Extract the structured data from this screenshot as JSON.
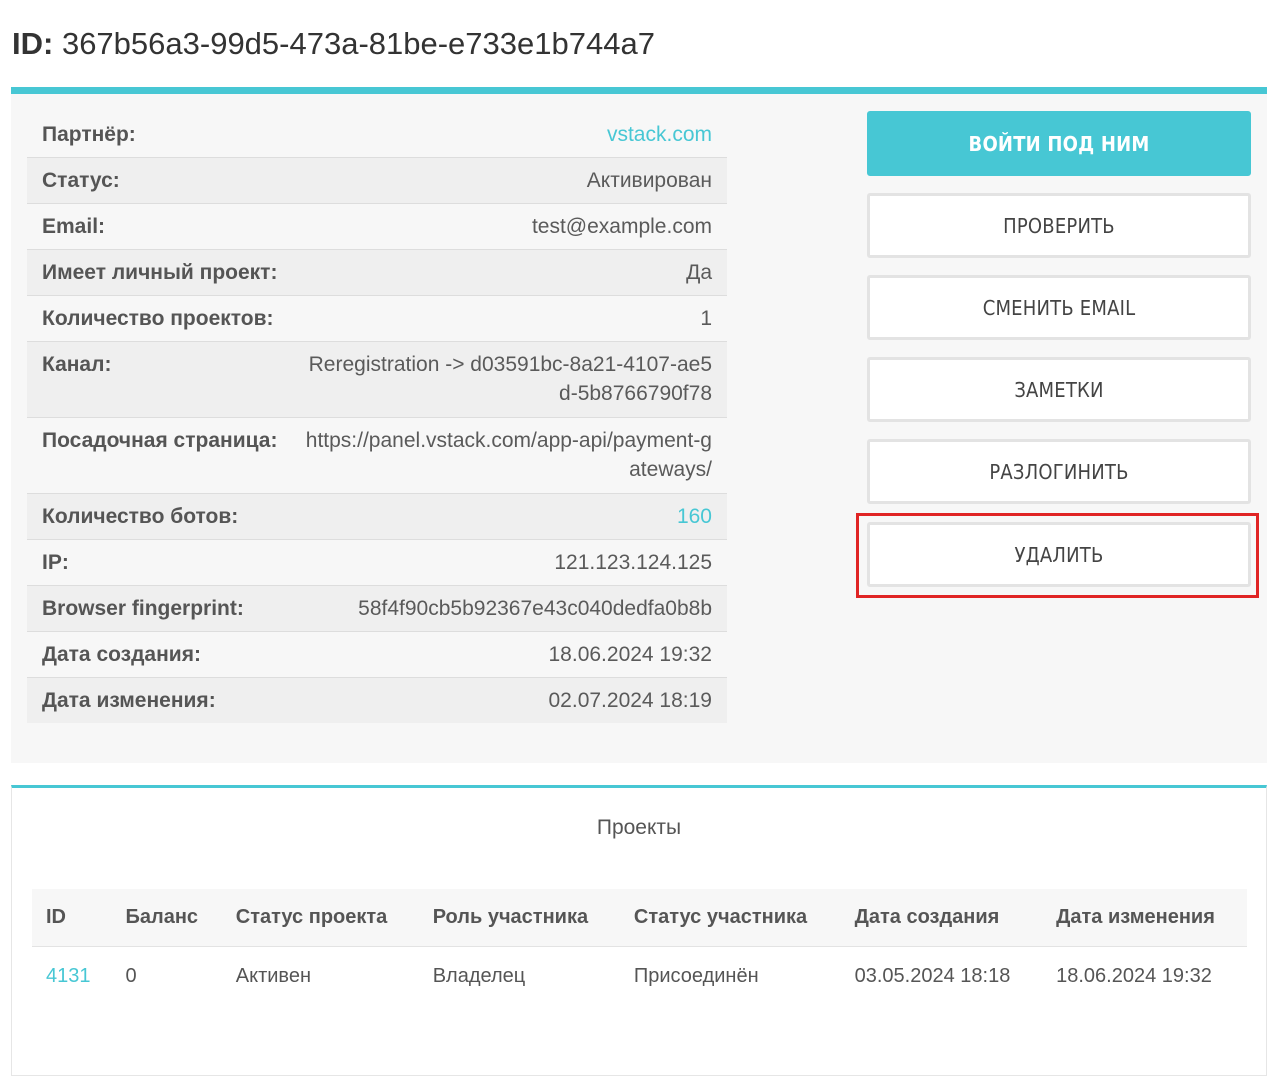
{
  "page": {
    "title_label": "ID:",
    "title_value": "367b56a3-99d5-473a-81be-e733e1b744a7"
  },
  "info": {
    "rows": [
      {
        "label": "Партнёр:",
        "value": "vstack.com"
      },
      {
        "label": "Статус:",
        "value": "Активирован"
      },
      {
        "label": "Email:",
        "value": "test@example.com"
      },
      {
        "label": "Имеет личный проект:",
        "value": "Да"
      },
      {
        "label": "Количество проектов:",
        "value": "1"
      },
      {
        "label": "Канал:",
        "value": "Reregistration -> d03591bc-8a21-4107-ae5d-5b8766790f78"
      },
      {
        "label": "Посадочная страница:",
        "value": "https://panel.vstack.com/app-api/payment-gateways/"
      },
      {
        "label": "Количество ботов:",
        "value": "160"
      },
      {
        "label": "IP:",
        "value": "121.123.124.125"
      },
      {
        "label": "Browser fingerprint:",
        "value": "58f4f90cb5b92367e43c040dedfa0b8b"
      },
      {
        "label": "Дата создания:",
        "value": "18.06.2024 19:32"
      },
      {
        "label": "Дата изменения:",
        "value": "02.07.2024 18:19"
      }
    ]
  },
  "actions": {
    "login_as": "ВОЙТИ ПОД НИМ",
    "check": "ПРОВЕРИТЬ",
    "change_email": "СМЕНИТЬ EMAIL",
    "notes": "ЗАМЕТКИ",
    "logout": "РАЗЛОГИНИТЬ",
    "delete": "УДАЛИТЬ"
  },
  "projects": {
    "title": "Проекты",
    "columns": [
      "ID",
      "Баланс",
      "Статус проекта",
      "Роль участника",
      "Статус участника",
      "Дата создания",
      "Дата изменения"
    ],
    "rows": [
      [
        "4131",
        "0",
        "Активен",
        "Владелец",
        "Присоединён",
        "03.05.2024 18:18",
        "18.06.2024 19:32"
      ]
    ]
  },
  "colors": {
    "accent": "#47c7d4",
    "highlight": "#e02424"
  }
}
